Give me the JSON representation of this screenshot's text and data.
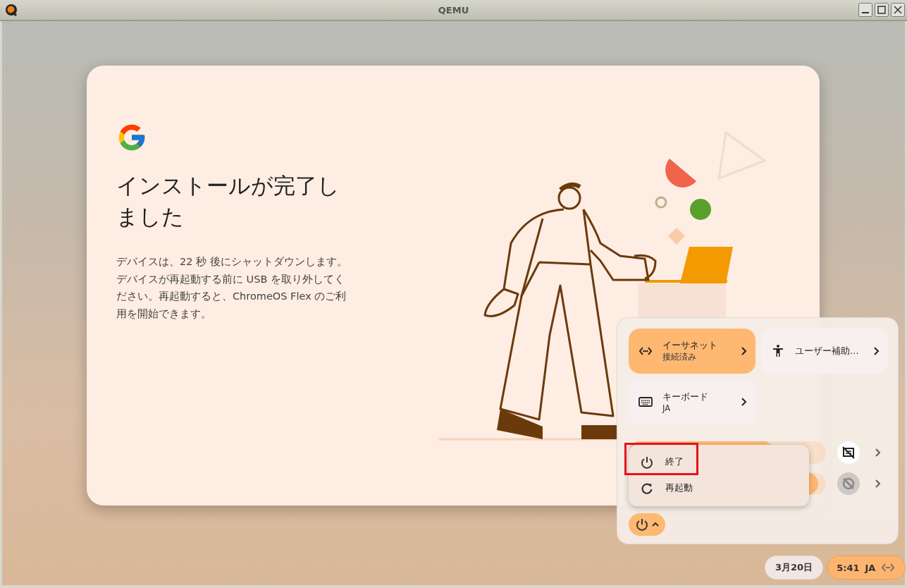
{
  "window": {
    "title": "QEMU"
  },
  "setup_card": {
    "title": "インストールが完了しました",
    "body": "デバイスは、22 秒 後にシャットダウンします。デバイスが再起動する前に USB を取り外してください。再起動すると、ChromeOS Flex のご利用を開始できます。"
  },
  "quick_settings": {
    "tiles": [
      {
        "kind": "ethernet",
        "label": "イーサネット",
        "sublabel": "接続済み",
        "on": true
      },
      {
        "kind": "accessibility",
        "label": "ユーザー補助…",
        "on": false
      },
      {
        "kind": "keyboard",
        "label": "キーボード",
        "sublabel": "JA",
        "on": false
      }
    ],
    "sliders": [
      {
        "level": 0.74,
        "button_disabled": false
      },
      {
        "level": 0.96,
        "button_disabled": true
      }
    ],
    "power_menu": {
      "items": [
        {
          "kind": "shutdown",
          "label": "終了",
          "highlighted": true
        },
        {
          "kind": "restart",
          "label": "再起動",
          "highlighted": false
        }
      ]
    },
    "power_button": {
      "expanded": true
    }
  },
  "shelf": {
    "date": "3月20日",
    "time": "5:41",
    "ime": "JA"
  }
}
